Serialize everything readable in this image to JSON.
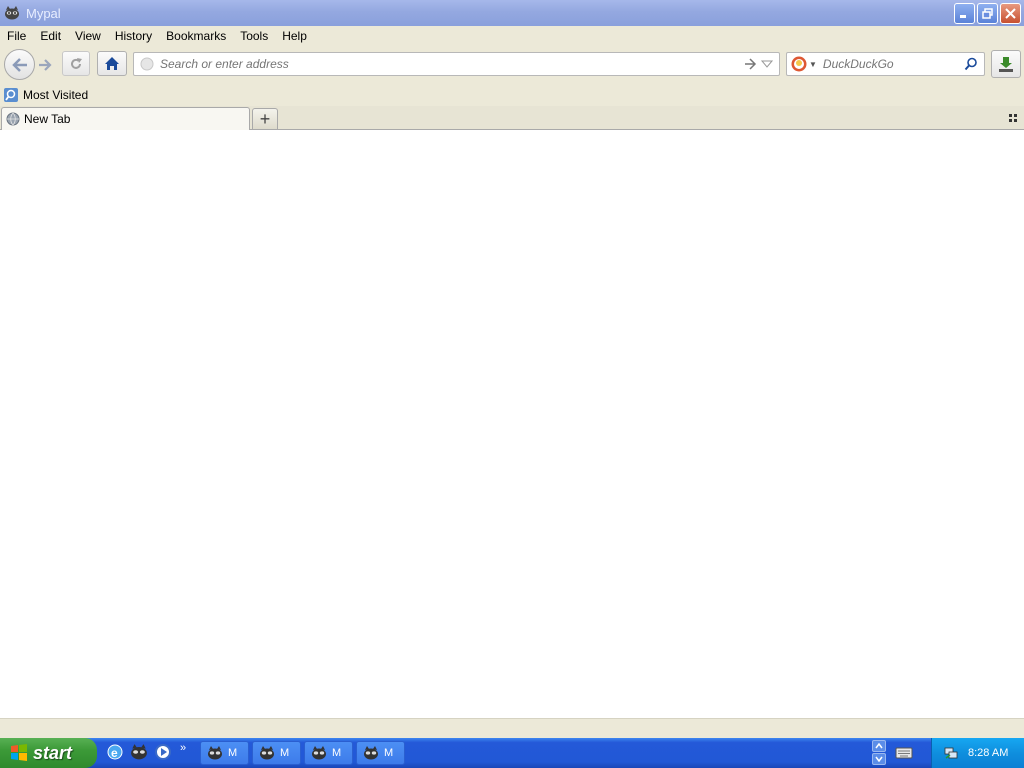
{
  "window": {
    "title": "Mypal",
    "app_icon": "raccoon-icon",
    "controls": [
      "minimize-icon",
      "restore-icon",
      "close-icon"
    ]
  },
  "menu": {
    "items": [
      "File",
      "Edit",
      "View",
      "History",
      "Bookmarks",
      "Tools",
      "Help"
    ]
  },
  "navbar": {
    "back_icon": "back-arrow-icon",
    "forward_icon": "forward-arrow-icon",
    "reload_icon": "reload-icon",
    "home_icon": "home-icon",
    "url_placeholder": "Search or enter address",
    "url_value": "",
    "search_engine": "duckduckgo-icon",
    "search_placeholder": "DuckDuckGo",
    "download_icon": "download-icon"
  },
  "bookmarks": {
    "items": [
      {
        "label": "Most Visited",
        "icon": "bookmark-folder-icon"
      }
    ]
  },
  "tabs": {
    "items": [
      {
        "label": "New Tab",
        "icon": "globe-icon",
        "active": true
      }
    ],
    "new_tab_label": "+"
  },
  "taskbar": {
    "start_label": "start",
    "quick_launch": [
      "internet-explorer-icon",
      "mypal-icon",
      "media-player-icon"
    ],
    "chevrons": "»",
    "task_buttons": [
      {
        "label": "M"
      },
      {
        "label": "M"
      },
      {
        "label": "M"
      },
      {
        "label": "M"
      }
    ],
    "clock": "8:28 AM"
  },
  "colors": {
    "titlebar": "#94a8e0",
    "chrome": "#ece9d8",
    "taskbar": "#2158d6",
    "start": "#3c9a38",
    "tray": "#0f8fde"
  }
}
